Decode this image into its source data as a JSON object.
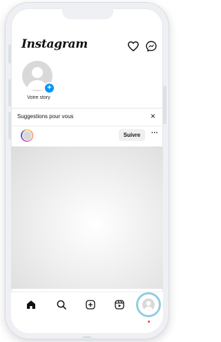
{
  "app": {
    "logo_text": "Instagram"
  },
  "top_bar": {
    "icons": [
      "heart-icon",
      "messenger-icon"
    ]
  },
  "stories": {
    "own_story_label": "Votre story"
  },
  "suggestions": {
    "title": "Suggestions pour vous",
    "close_symbol": "×"
  },
  "post": {
    "follow_label": "Suivre",
    "more_symbol": "···"
  },
  "bottom_nav": {
    "items": [
      "home-icon",
      "search-icon",
      "add-post-icon",
      "reels-icon",
      "profile-icon"
    ],
    "active": "profile-icon",
    "notification_dot_color": "#ff3040"
  },
  "colors": {
    "accent_blue": "#0095f6",
    "profile_highlight": "#8fcde0"
  }
}
